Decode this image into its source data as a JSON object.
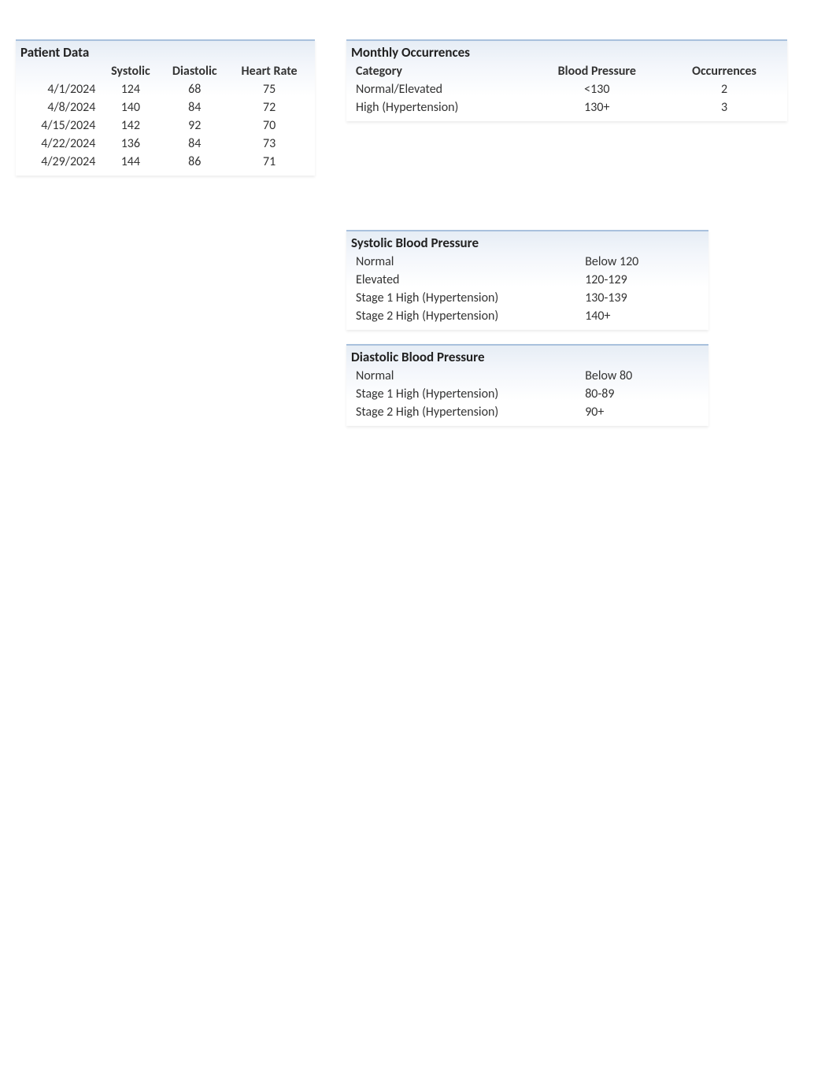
{
  "patient": {
    "title": "Patient Data",
    "headers": {
      "date": "",
      "systolic": "Systolic",
      "diastolic": "Diastolic",
      "heart_rate": "Heart Rate"
    },
    "rows": [
      {
        "date": "4/1/2024",
        "systolic": "124",
        "diastolic": "68",
        "heart_rate": "75"
      },
      {
        "date": "4/8/2024",
        "systolic": "140",
        "diastolic": "84",
        "heart_rate": "72"
      },
      {
        "date": "4/15/2024",
        "systolic": "142",
        "diastolic": "92",
        "heart_rate": "70"
      },
      {
        "date": "4/22/2024",
        "systolic": "136",
        "diastolic": "84",
        "heart_rate": "73"
      },
      {
        "date": "4/29/2024",
        "systolic": "144",
        "diastolic": "86",
        "heart_rate": "71"
      }
    ]
  },
  "monthly": {
    "title": "Monthly Occurrences",
    "headers": {
      "category": "Category",
      "bp": "Blood Pressure",
      "occ": "Occurrences"
    },
    "rows": [
      {
        "category": "Normal/Elevated",
        "bp": "<130",
        "occ": "2"
      },
      {
        "category": "High (Hypertension)",
        "bp": "130+",
        "occ": "3"
      }
    ]
  },
  "systolic_ref": {
    "title": "Systolic Blood Pressure",
    "rows": [
      {
        "label": "Normal",
        "range": "Below 120"
      },
      {
        "label": "Elevated",
        "range": "120-129"
      },
      {
        "label": "Stage 1 High (Hypertension)",
        "range": "130-139"
      },
      {
        "label": "Stage 2 High (Hypertension)",
        "range": "140+"
      }
    ]
  },
  "diastolic_ref": {
    "title": "Diastolic Blood Pressure",
    "rows": [
      {
        "label": "Normal",
        "range": "Below 80"
      },
      {
        "label": "Stage 1 High (Hypertension)",
        "range": "80-89"
      },
      {
        "label": "Stage 2 High (Hypertension)",
        "range": "90+"
      }
    ]
  }
}
